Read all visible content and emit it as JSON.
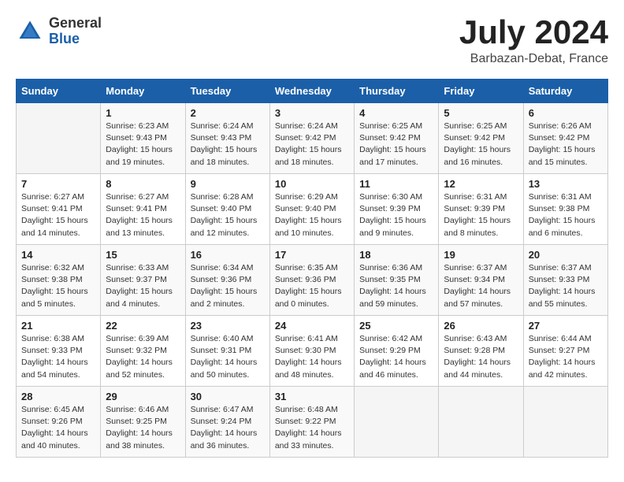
{
  "logo": {
    "general": "General",
    "blue": "Blue"
  },
  "title": "July 2024",
  "location": "Barbazan-Debat, France",
  "days_of_week": [
    "Sunday",
    "Monday",
    "Tuesday",
    "Wednesday",
    "Thursday",
    "Friday",
    "Saturday"
  ],
  "weeks": [
    [
      {
        "day": "",
        "info": ""
      },
      {
        "day": "1",
        "info": "Sunrise: 6:23 AM\nSunset: 9:43 PM\nDaylight: 15 hours\nand 19 minutes."
      },
      {
        "day": "2",
        "info": "Sunrise: 6:24 AM\nSunset: 9:43 PM\nDaylight: 15 hours\nand 18 minutes."
      },
      {
        "day": "3",
        "info": "Sunrise: 6:24 AM\nSunset: 9:42 PM\nDaylight: 15 hours\nand 18 minutes."
      },
      {
        "day": "4",
        "info": "Sunrise: 6:25 AM\nSunset: 9:42 PM\nDaylight: 15 hours\nand 17 minutes."
      },
      {
        "day": "5",
        "info": "Sunrise: 6:25 AM\nSunset: 9:42 PM\nDaylight: 15 hours\nand 16 minutes."
      },
      {
        "day": "6",
        "info": "Sunrise: 6:26 AM\nSunset: 9:42 PM\nDaylight: 15 hours\nand 15 minutes."
      }
    ],
    [
      {
        "day": "7",
        "info": "Sunrise: 6:27 AM\nSunset: 9:41 PM\nDaylight: 15 hours\nand 14 minutes."
      },
      {
        "day": "8",
        "info": "Sunrise: 6:27 AM\nSunset: 9:41 PM\nDaylight: 15 hours\nand 13 minutes."
      },
      {
        "day": "9",
        "info": "Sunrise: 6:28 AM\nSunset: 9:40 PM\nDaylight: 15 hours\nand 12 minutes."
      },
      {
        "day": "10",
        "info": "Sunrise: 6:29 AM\nSunset: 9:40 PM\nDaylight: 15 hours\nand 10 minutes."
      },
      {
        "day": "11",
        "info": "Sunrise: 6:30 AM\nSunset: 9:39 PM\nDaylight: 15 hours\nand 9 minutes."
      },
      {
        "day": "12",
        "info": "Sunrise: 6:31 AM\nSunset: 9:39 PM\nDaylight: 15 hours\nand 8 minutes."
      },
      {
        "day": "13",
        "info": "Sunrise: 6:31 AM\nSunset: 9:38 PM\nDaylight: 15 hours\nand 6 minutes."
      }
    ],
    [
      {
        "day": "14",
        "info": "Sunrise: 6:32 AM\nSunset: 9:38 PM\nDaylight: 15 hours\nand 5 minutes."
      },
      {
        "day": "15",
        "info": "Sunrise: 6:33 AM\nSunset: 9:37 PM\nDaylight: 15 hours\nand 4 minutes."
      },
      {
        "day": "16",
        "info": "Sunrise: 6:34 AM\nSunset: 9:36 PM\nDaylight: 15 hours\nand 2 minutes."
      },
      {
        "day": "17",
        "info": "Sunrise: 6:35 AM\nSunset: 9:36 PM\nDaylight: 15 hours\nand 0 minutes."
      },
      {
        "day": "18",
        "info": "Sunrise: 6:36 AM\nSunset: 9:35 PM\nDaylight: 14 hours\nand 59 minutes."
      },
      {
        "day": "19",
        "info": "Sunrise: 6:37 AM\nSunset: 9:34 PM\nDaylight: 14 hours\nand 57 minutes."
      },
      {
        "day": "20",
        "info": "Sunrise: 6:37 AM\nSunset: 9:33 PM\nDaylight: 14 hours\nand 55 minutes."
      }
    ],
    [
      {
        "day": "21",
        "info": "Sunrise: 6:38 AM\nSunset: 9:33 PM\nDaylight: 14 hours\nand 54 minutes."
      },
      {
        "day": "22",
        "info": "Sunrise: 6:39 AM\nSunset: 9:32 PM\nDaylight: 14 hours\nand 52 minutes."
      },
      {
        "day": "23",
        "info": "Sunrise: 6:40 AM\nSunset: 9:31 PM\nDaylight: 14 hours\nand 50 minutes."
      },
      {
        "day": "24",
        "info": "Sunrise: 6:41 AM\nSunset: 9:30 PM\nDaylight: 14 hours\nand 48 minutes."
      },
      {
        "day": "25",
        "info": "Sunrise: 6:42 AM\nSunset: 9:29 PM\nDaylight: 14 hours\nand 46 minutes."
      },
      {
        "day": "26",
        "info": "Sunrise: 6:43 AM\nSunset: 9:28 PM\nDaylight: 14 hours\nand 44 minutes."
      },
      {
        "day": "27",
        "info": "Sunrise: 6:44 AM\nSunset: 9:27 PM\nDaylight: 14 hours\nand 42 minutes."
      }
    ],
    [
      {
        "day": "28",
        "info": "Sunrise: 6:45 AM\nSunset: 9:26 PM\nDaylight: 14 hours\nand 40 minutes."
      },
      {
        "day": "29",
        "info": "Sunrise: 6:46 AM\nSunset: 9:25 PM\nDaylight: 14 hours\nand 38 minutes."
      },
      {
        "day": "30",
        "info": "Sunrise: 6:47 AM\nSunset: 9:24 PM\nDaylight: 14 hours\nand 36 minutes."
      },
      {
        "day": "31",
        "info": "Sunrise: 6:48 AM\nSunset: 9:22 PM\nDaylight: 14 hours\nand 33 minutes."
      },
      {
        "day": "",
        "info": ""
      },
      {
        "day": "",
        "info": ""
      },
      {
        "day": "",
        "info": ""
      }
    ]
  ]
}
